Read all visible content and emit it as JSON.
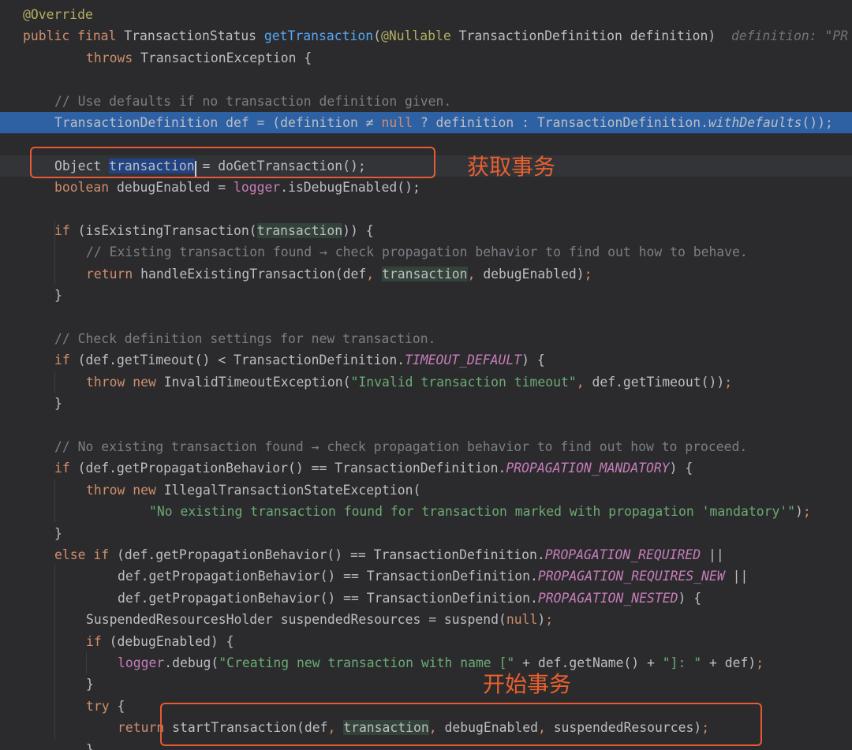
{
  "editor": {
    "lines": [
      {
        "tokens": [
          {
            "t": "@Override",
            "c": "ann"
          }
        ]
      },
      {
        "tokens": [
          {
            "t": "public ",
            "c": "kw"
          },
          {
            "t": "final ",
            "c": "kw"
          },
          {
            "t": "TransactionStatus ",
            "c": "default"
          },
          {
            "t": "getTransaction",
            "c": "func"
          },
          {
            "t": "(",
            "c": "default"
          },
          {
            "t": "@Nullable ",
            "c": "ann"
          },
          {
            "t": "TransactionDefinition definition)  ",
            "c": "default"
          },
          {
            "t": "definition: \"PR",
            "c": "hint"
          }
        ]
      },
      {
        "indent": 2,
        "tokens": [
          {
            "t": "throws ",
            "c": "kw"
          },
          {
            "t": "TransactionException {",
            "c": "default"
          }
        ]
      },
      {
        "tokens": []
      },
      {
        "indent": 1,
        "tokens": [
          {
            "t": "// Use defaults if no transaction definition given.",
            "c": "cmt"
          }
        ]
      },
      {
        "indent": 1,
        "hl": true,
        "tokens": [
          {
            "t": "TransactionDefinition def = (definition ≠ ",
            "c": "default"
          },
          {
            "t": "null",
            "c": "kw"
          },
          {
            "t": " ? definition : TransactionDefinition.",
            "c": "default"
          },
          {
            "t": "withDefaults",
            "c": "static"
          },
          {
            "t": "());",
            "c": "default"
          }
        ]
      },
      {
        "tokens": []
      },
      {
        "indent": 1,
        "caret": true,
        "tokens": [
          {
            "t": "Object ",
            "c": "default"
          },
          {
            "t": "transaction",
            "c": "sel"
          },
          {
            "t": " = doGetTransaction();",
            "c": "default"
          }
        ]
      },
      {
        "indent": 1,
        "tokens": [
          {
            "t": "boolean ",
            "c": "kw"
          },
          {
            "t": "debugEnabled = ",
            "c": "default"
          },
          {
            "t": "logger",
            "c": "field"
          },
          {
            "t": ".isDebugEnabled();",
            "c": "default"
          }
        ]
      },
      {
        "tokens": []
      },
      {
        "indent": 1,
        "tokens": [
          {
            "t": "if ",
            "c": "kw"
          },
          {
            "t": "(isExistingTransaction(",
            "c": "default"
          },
          {
            "t": "transaction",
            "c": "usage"
          },
          {
            "t": ")) {",
            "c": "default"
          }
        ]
      },
      {
        "indent": 2,
        "tokens": [
          {
            "t": "// Existing transaction found → check propagation behavior to find out how to behave.",
            "c": "cmt"
          }
        ]
      },
      {
        "indent": 2,
        "tokens": [
          {
            "t": "return ",
            "c": "kw"
          },
          {
            "t": "handleExistingTransaction(def",
            "c": "default"
          },
          {
            "t": ", ",
            "c": "comma"
          },
          {
            "t": "transaction",
            "c": "usage"
          },
          {
            "t": ", ",
            "c": "comma"
          },
          {
            "t": "debugEnabled)",
            "c": "default"
          },
          {
            "t": ";",
            "c": "comma"
          }
        ]
      },
      {
        "indent": 1,
        "tokens": [
          {
            "t": "}",
            "c": "default"
          }
        ]
      },
      {
        "tokens": []
      },
      {
        "indent": 1,
        "tokens": [
          {
            "t": "// Check definition settings for new transaction.",
            "c": "cmt"
          }
        ]
      },
      {
        "indent": 1,
        "tokens": [
          {
            "t": "if ",
            "c": "kw"
          },
          {
            "t": "(def.getTimeout() < TransactionDefinition.",
            "c": "default"
          },
          {
            "t": "TIMEOUT_DEFAULT",
            "c": "const"
          },
          {
            "t": ") {",
            "c": "default"
          }
        ]
      },
      {
        "indent": 2,
        "tokens": [
          {
            "t": "throw new ",
            "c": "kw"
          },
          {
            "t": "InvalidTimeoutException(",
            "c": "default"
          },
          {
            "t": "\"Invalid transaction timeout\"",
            "c": "str"
          },
          {
            "t": ", ",
            "c": "comma"
          },
          {
            "t": "def.getTimeout())",
            "c": "default"
          },
          {
            "t": ";",
            "c": "comma"
          }
        ]
      },
      {
        "indent": 1,
        "tokens": [
          {
            "t": "}",
            "c": "default"
          }
        ]
      },
      {
        "tokens": []
      },
      {
        "indent": 1,
        "tokens": [
          {
            "t": "// No existing transaction found → check propagation behavior to find out how to proceed.",
            "c": "cmt"
          }
        ]
      },
      {
        "indent": 1,
        "tokens": [
          {
            "t": "if ",
            "c": "kw"
          },
          {
            "t": "(def.getPropagationBehavior() == TransactionDefinition.",
            "c": "default"
          },
          {
            "t": "PROPAGATION_MANDATORY",
            "c": "const"
          },
          {
            "t": ") {",
            "c": "default"
          }
        ]
      },
      {
        "indent": 2,
        "tokens": [
          {
            "t": "throw new ",
            "c": "kw"
          },
          {
            "t": "IllegalTransactionStateException(",
            "c": "default"
          }
        ]
      },
      {
        "indent": 4,
        "tokens": [
          {
            "t": "\"No existing transaction found for transaction marked with propagation 'mandatory'\"",
            "c": "str"
          },
          {
            "t": ")",
            "c": "default"
          },
          {
            "t": ";",
            "c": "comma"
          }
        ]
      },
      {
        "indent": 1,
        "tokens": [
          {
            "t": "}",
            "c": "default"
          }
        ]
      },
      {
        "indent": 1,
        "tokens": [
          {
            "t": "else if ",
            "c": "kw"
          },
          {
            "t": "(def.getPropagationBehavior() == TransactionDefinition.",
            "c": "default"
          },
          {
            "t": "PROPAGATION_REQUIRED",
            "c": "const"
          },
          {
            "t": " ||",
            "c": "default"
          }
        ]
      },
      {
        "indent": 3,
        "tokens": [
          {
            "t": "def.getPropagationBehavior() == TransactionDefinition.",
            "c": "default"
          },
          {
            "t": "PROPAGATION_REQUIRES_NEW",
            "c": "const"
          },
          {
            "t": " ||",
            "c": "default"
          }
        ]
      },
      {
        "indent": 3,
        "tokens": [
          {
            "t": "def.getPropagationBehavior() == TransactionDefinition.",
            "c": "default"
          },
          {
            "t": "PROPAGATION_NESTED",
            "c": "const"
          },
          {
            "t": ") {",
            "c": "default"
          }
        ]
      },
      {
        "indent": 2,
        "tokens": [
          {
            "t": "SuspendedResourcesHolder suspendedResources = suspend(",
            "c": "default"
          },
          {
            "t": "null",
            "c": "kw"
          },
          {
            "t": ")",
            "c": "default"
          },
          {
            "t": ";",
            "c": "comma"
          }
        ]
      },
      {
        "indent": 2,
        "tokens": [
          {
            "t": "if ",
            "c": "kw"
          },
          {
            "t": "(debugEnabled) {",
            "c": "default"
          }
        ]
      },
      {
        "indent": 3,
        "tokens": [
          {
            "t": "logger",
            "c": "field"
          },
          {
            "t": ".debug(",
            "c": "default"
          },
          {
            "t": "\"Creating new transaction with name [\"",
            "c": "str"
          },
          {
            "t": " + def.getName() + ",
            "c": "default"
          },
          {
            "t": "\"]: \"",
            "c": "str"
          },
          {
            "t": " + def)",
            "c": "default"
          },
          {
            "t": ";",
            "c": "comma"
          }
        ]
      },
      {
        "indent": 2,
        "tokens": [
          {
            "t": "}",
            "c": "default"
          }
        ]
      },
      {
        "indent": 2,
        "tokens": [
          {
            "t": "try ",
            "c": "kw"
          },
          {
            "t": "{",
            "c": "default"
          }
        ]
      },
      {
        "indent": 3,
        "tokens": [
          {
            "t": "return ",
            "c": "kw"
          },
          {
            "t": "startTransaction(def",
            "c": "default"
          },
          {
            "t": ", ",
            "c": "comma"
          },
          {
            "t": "transaction",
            "c": "usage"
          },
          {
            "t": ", ",
            "c": "comma"
          },
          {
            "t": "debugEnabled",
            "c": "default"
          },
          {
            "t": ", ",
            "c": "comma"
          },
          {
            "t": "suspendedResources)",
            "c": "default"
          },
          {
            "t": ";",
            "c": "comma"
          }
        ]
      },
      {
        "indent": 2,
        "tokens": [
          {
            "t": "}",
            "c": "default"
          }
        ]
      }
    ]
  },
  "annotations": {
    "get_transaction_label": "获取事务",
    "start_transaction_label": "开始事务",
    "accent_color": "#e85a34"
  }
}
